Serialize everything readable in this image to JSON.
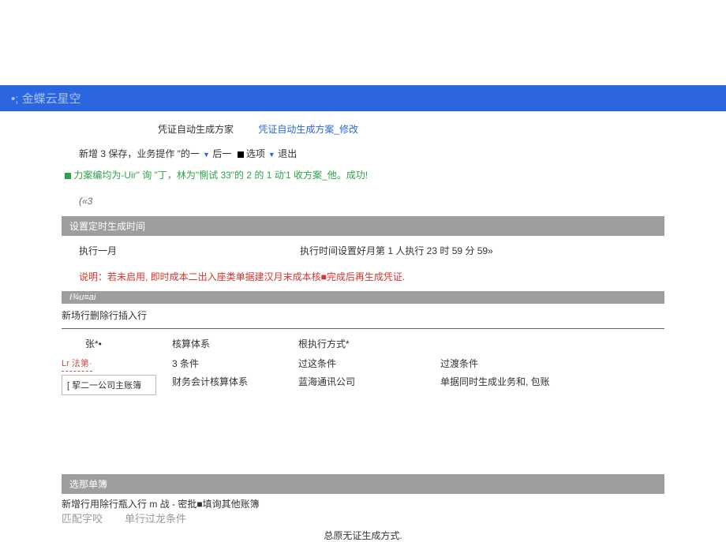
{
  "header": {
    "brand": "•; 金蝶云星空"
  },
  "breadcrumb": {
    "current": "凭证自动生成方家",
    "link": "凭证自动生成方案_修改"
  },
  "toolbar": {
    "t1": "新增 3 保存，业务提作 \"的一",
    "t2": "后一",
    "t3": "选项",
    "t4": "退出"
  },
  "status": "力案编均为-Uir\" 询 \"丁，林为\"惻试 33\"的 2 的 1 动'1 收方案_他。成功!",
  "misc": "(«3",
  "sec1": {
    "title": "设置定时生成时间",
    "col1": "执行一月",
    "col2": "执行时间设置好月第 1 人执行 23 时 59 分 59»",
    "note": "说明：若未启用, 即时成本二出入座类单据建汉月末成本核■完成后再生成凭证."
  },
  "sec2": {
    "title": "I¾u≡ai",
    "actions": "新场行删除行插入行",
    "head": {
      "h1": "张*•",
      "h2": "核算体系",
      "h3": "根执行方式*"
    },
    "ledger_label": "Lr 法第·",
    "company": "[ 挈二一公司主账簿",
    "c2a": "3 条件",
    "c2b": "财务会计核算体系",
    "c3a": "过这条件",
    "c3b": "蓝海通讯公司",
    "c4a": "过渡条件",
    "c4b": "单据同时生成业务和, 包账"
  },
  "sec3": {
    "title": "选那单簿",
    "actions": "新增行用除行瓶入行 m 战 - 密批■填询其他账簿",
    "fa": "匹配字咬",
    "fb": "单行过龙条件",
    "center": "总原无证生成方式."
  }
}
